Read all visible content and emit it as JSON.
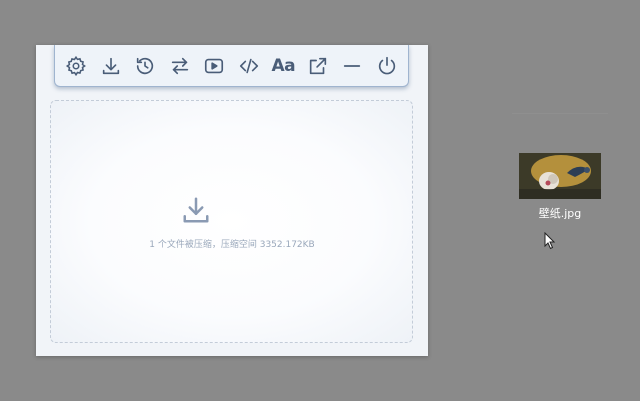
{
  "toolbar": {
    "items": [
      {
        "name": "settings-button",
        "icon": "gear-icon"
      },
      {
        "name": "download-button",
        "icon": "download-icon"
      },
      {
        "name": "history-button",
        "icon": "history-icon"
      },
      {
        "name": "swap-button",
        "icon": "swap-arrows-icon"
      },
      {
        "name": "play-button",
        "icon": "play-icon"
      },
      {
        "name": "code-button",
        "icon": "code-icon"
      },
      {
        "name": "font-button",
        "icon": "font-icon",
        "text": "Aa"
      },
      {
        "name": "share-button",
        "icon": "external-share-icon"
      },
      {
        "name": "minimize-button",
        "icon": "minus-icon"
      },
      {
        "name": "power-button",
        "icon": "power-icon"
      }
    ]
  },
  "drop_zone": {
    "icon": "download-icon",
    "status": "1 个文件被压缩，压缩空间 3352.172KB"
  },
  "desktop_file": {
    "name": "壁纸.jpg",
    "icon": "image-thumbnail-icon"
  },
  "colors": {
    "icon_stroke": "#4a5d78",
    "drop_icon": "#8a9ab3",
    "desktop_bg": "#8a8a8a",
    "toolbar_border": "#9fb4cf"
  }
}
